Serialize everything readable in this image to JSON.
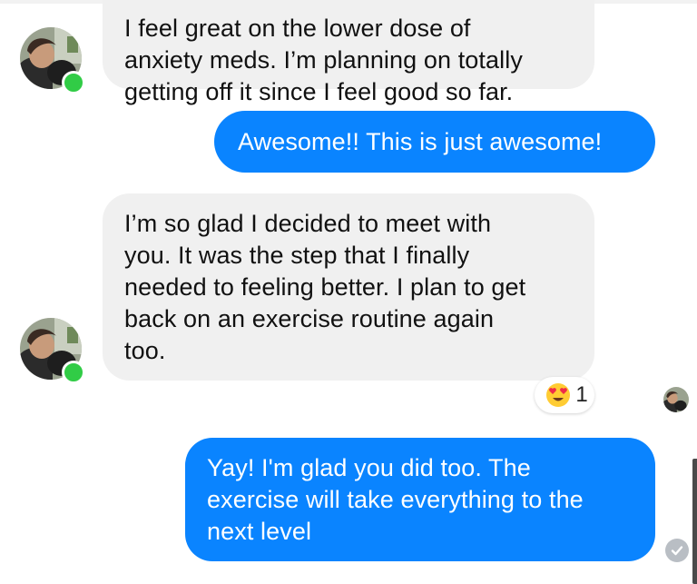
{
  "conversation": {
    "messages": [
      {
        "direction": "incoming",
        "text": "I feel great on the lower dose of\nanxiety meds. I’m planning on totally\ngetting off it since I feel good so far."
      },
      {
        "direction": "outgoing",
        "text": "Awesome!! This is just awesome!"
      },
      {
        "direction": "incoming",
        "text": "I’m so glad I decided to meet with\nyou. It was the step that I finally\nneeded to feeling better. I plan to get\nback on an exercise routine again\ntoo."
      },
      {
        "direction": "outgoing",
        "text": "Yay! I'm glad you did too. The\nexercise will take everything to the\nnext level"
      }
    ],
    "reaction": {
      "icon": "heart-eyes-emoji-icon",
      "count": "1"
    },
    "status": {
      "seen_icon": "seen-avatar-icon",
      "delivered_icon": "delivered-check-icon"
    }
  },
  "colors": {
    "outgoing_bubble": "#0a84ff",
    "incoming_bubble": "#f0f0f0",
    "online": "#31cc46"
  }
}
